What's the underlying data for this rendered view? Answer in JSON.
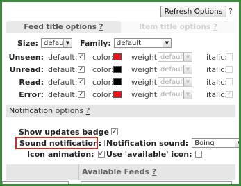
{
  "toolbar": {
    "refresh_label": "Refresh Options",
    "help_label": "?"
  },
  "tabs": [
    {
      "label": "Feed title options",
      "help": "?"
    },
    {
      "label": "Item title options",
      "help": "?"
    }
  ],
  "feed_title": {
    "size_label": "Size:",
    "size_value": "default",
    "family_label": "Family:",
    "family_value": "default",
    "col_default": "default:",
    "col_color": "color:",
    "col_weight": "weight:",
    "col_italic": "italic:",
    "rows": [
      {
        "label": "Unseen:",
        "default_checked": "✓",
        "color": "#e8141a",
        "weight": "default",
        "italic_checked": ""
      },
      {
        "label": "Unread:",
        "default_checked": "✓",
        "color": "#000000",
        "weight": "default",
        "italic_checked": ""
      },
      {
        "label": "Read:",
        "default_checked": "✓",
        "color": "#000000",
        "weight": "default",
        "italic_checked": ""
      },
      {
        "label": "Error:",
        "default_checked": "✓",
        "color": "#e8141a",
        "weight": "default",
        "italic_checked": "✓"
      }
    ]
  },
  "notification": {
    "title": "Notification options",
    "help": "?",
    "show_badge_label": "Show updates badge",
    "show_badge_checked": "✓",
    "sound_label": "Sound notification:",
    "sound_checked": "",
    "notification_sound_label": "Notification sound:",
    "notification_sound_value": "Boing",
    "icon_animation_label": "Icon animation:",
    "icon_animation_checked": "✓",
    "use_available_label": "Use 'available' icon:",
    "use_available_checked": ""
  },
  "feeds": {
    "title": "Available Feeds",
    "help": "?"
  },
  "colors": {
    "frame": "#3c8b3a",
    "highlight": "#c8302a"
  }
}
